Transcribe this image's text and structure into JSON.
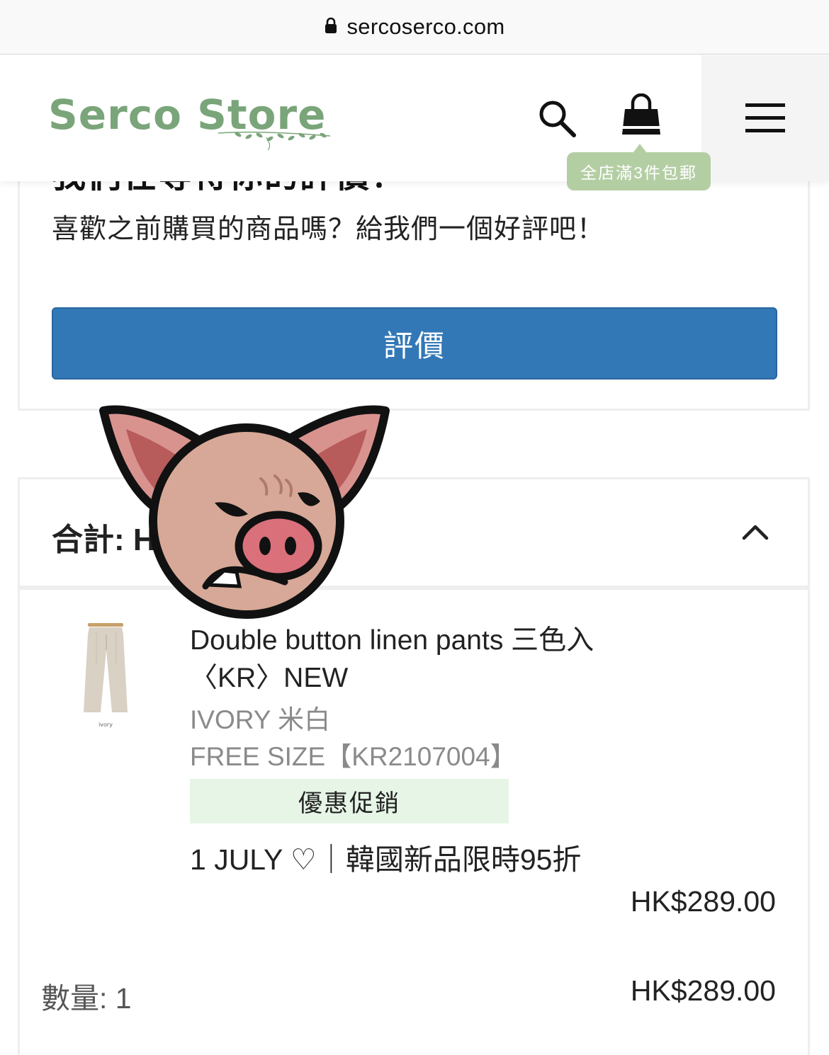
{
  "browser": {
    "url": "sercoserco.com",
    "lock_icon": "lock-icon"
  },
  "header": {
    "logo_text": "Serco Store",
    "icons": [
      "search-icon",
      "shopping-bag-icon",
      "hamburger-menu-icon"
    ],
    "free_shipping_tooltip": "全店滿3件包郵",
    "brand_color": "#7aa57a",
    "tooltip_color": "#b4cea4"
  },
  "review": {
    "title": "我們在等待你的評價！",
    "subtitle": "喜歡之前購買的商品嗎？給我們一個好評吧！",
    "button_label": "評價",
    "button_color": "#3278b6"
  },
  "summary": {
    "total_label": "合計: H",
    "toggle_icon": "chevron-up-icon"
  },
  "item": {
    "name": "Double button linen pants 三色入〈KR〉NEW",
    "color": "IVORY 米白",
    "size": "FREE SIZE【KR2107004】",
    "thumbnail_caption": "ivory",
    "promo_badge": "優惠促銷",
    "promo_text": "1 JULY ♡｜韓國新品限時95折",
    "unit_price": "HK$289.00",
    "quantity_label": "數量: 1",
    "line_total": "HK$289.00",
    "promo_badge_color": "#e6f5e6"
  },
  "overlay": {
    "sticker": "angry-pig-sticker"
  }
}
